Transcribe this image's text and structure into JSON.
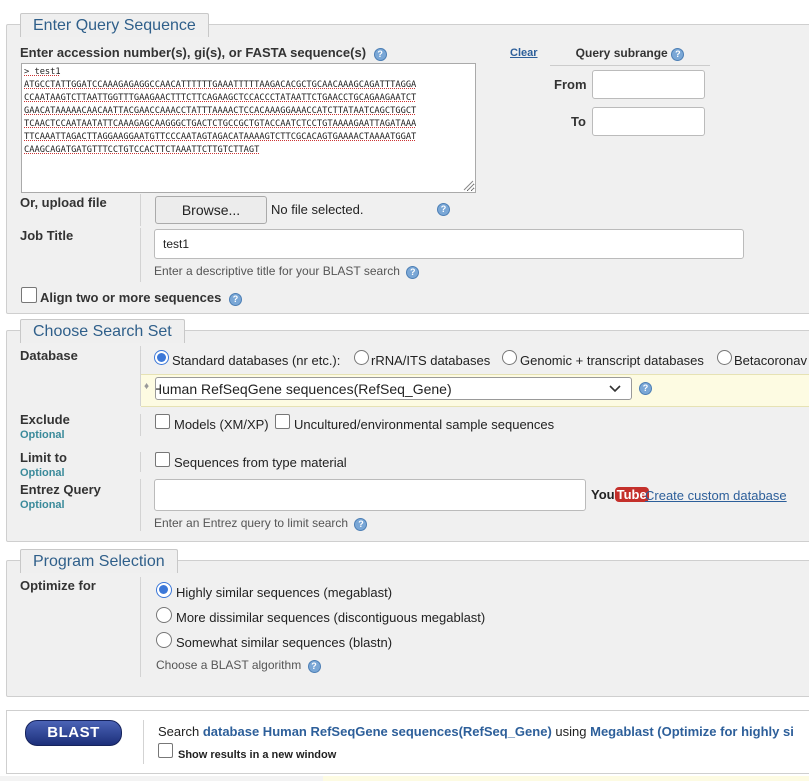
{
  "query": {
    "section_title": "Enter Query Sequence",
    "sequence_label": "Enter accession number(s), gi(s), or FASTA sequence(s)",
    "clear_label": "Clear",
    "subrange_label": "Query subrange",
    "from_label": "From",
    "to_label": "To",
    "from_value": "",
    "to_value": "",
    "sequence_text": "> test1\nATGCCTATTGGATCCAAAGAGAGGCCAACATTTTTTGAAATTTTTAAGACACGCTGCAACAAAGCAGATTTAGGA\nCCAATAAGTCTTAATTGGTTTGAAGAACTTTCTTCAGAAGCTCCACCCTATAATTCTGAACCTGCAGAAGAATCT\nGAACATAAAAACAACAATTACGAACCAAACCTATTTAAAACTCCACAAAGGAAACCATCTTATAATCAGCTGGCT\nTCAACTCCAATAATATTCAAAGAGCAAGGGCTGACTCTGCCGCTGTACCAATCTCCTGTAAAAGAATTAGATAAA\nTTCAAATTAGACTTAGGAAGGAATGTTCCCAATAGTAGACATAAAAGTCTTCGCACAGTGAAAACTAAAATGGAT\nCAAGCAGATGATGTTTCCTGTCCACTTCTAAATTCTTGTCTTAGT",
    "upload_label": "Or, upload file",
    "browse_label": "Browse...",
    "file_status": "No file selected.",
    "job_title_label": "Job Title",
    "job_title_value": "test1",
    "job_title_hint": "Enter a descriptive title for your BLAST search",
    "align_label": "Align two or more sequences"
  },
  "search_set": {
    "section_title": "Choose Search Set",
    "database_label": "Database",
    "db_options": [
      "Standard databases (nr etc.):",
      "rRNA/ITS databases",
      "Genomic + transcript databases",
      "Betacoronav"
    ],
    "db_selected_index": 0,
    "db_select_value": "Human RefSeqGene sequences(RefSeq_Gene)",
    "exclude_label": "Exclude",
    "optional_label": "Optional",
    "exclude_models": "Models (XM/XP)",
    "exclude_uncultured": "Uncultured/environmental sample sequences",
    "limit_label": "Limit to",
    "limit_type_material": "Sequences from type material",
    "entrez_label": "Entrez Query",
    "entrez_value": "",
    "youtube_you": "You",
    "youtube_tube": "Tube",
    "custom_db_link": "Create custom database",
    "entrez_hint": "Enter an Entrez query to limit search"
  },
  "program": {
    "section_title": "Program Selection",
    "optimize_label": "Optimize for",
    "options": [
      "Highly similar sequences (megablast)",
      "More dissimilar sequences (discontiguous megablast)",
      "Somewhat similar sequences (blastn)"
    ],
    "selected_index": 0,
    "hint": "Choose a BLAST algorithm"
  },
  "blast_bar": {
    "button_label": "BLAST",
    "summary_prefix": "Search",
    "summary_db": "database Human RefSeqGene sequences(RefSeq_Gene)",
    "summary_using": "using",
    "summary_algo": "Megablast (Optimize for highly si",
    "new_window_label": "Show results in a new window"
  },
  "colors": {
    "legend_text": "#2f5f8a",
    "link": "#2d5f9a",
    "optional": "#3a8a9a",
    "db_highlight": "#fdfbe2",
    "blast_button": "#1c2f7a"
  }
}
